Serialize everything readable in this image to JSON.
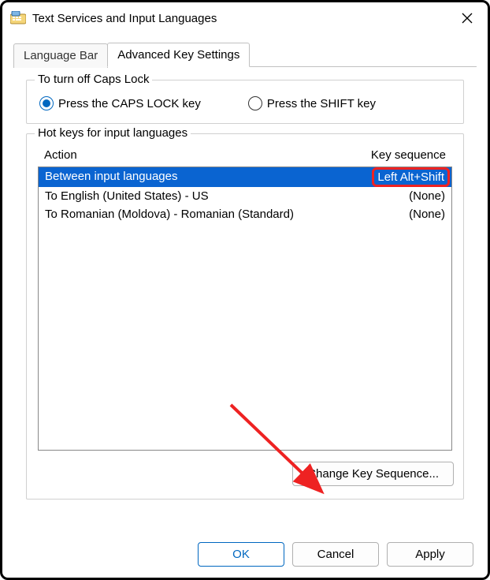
{
  "window": {
    "title": "Text Services and Input Languages"
  },
  "tabs": {
    "language_bar": "Language Bar",
    "advanced": "Advanced Key Settings"
  },
  "capslock": {
    "legend": "To turn off Caps Lock",
    "opt_caps": "Press the CAPS LOCK key",
    "opt_shift": "Press the SHIFT key",
    "selected": "caps"
  },
  "hotkeys": {
    "legend": "Hot keys for input languages",
    "col_action": "Action",
    "col_keyseq": "Key sequence",
    "rows": [
      {
        "action": "Between input languages",
        "keyseq": "Left Alt+Shift",
        "selected": true
      },
      {
        "action": "To English (United States) - US",
        "keyseq": "(None)",
        "selected": false
      },
      {
        "action": "To Romanian (Moldova) - Romanian (Standard)",
        "keyseq": "(None)",
        "selected": false
      }
    ],
    "change_btn": "Change Key Sequence..."
  },
  "buttons": {
    "ok": "OK",
    "cancel": "Cancel",
    "apply": "Apply"
  }
}
